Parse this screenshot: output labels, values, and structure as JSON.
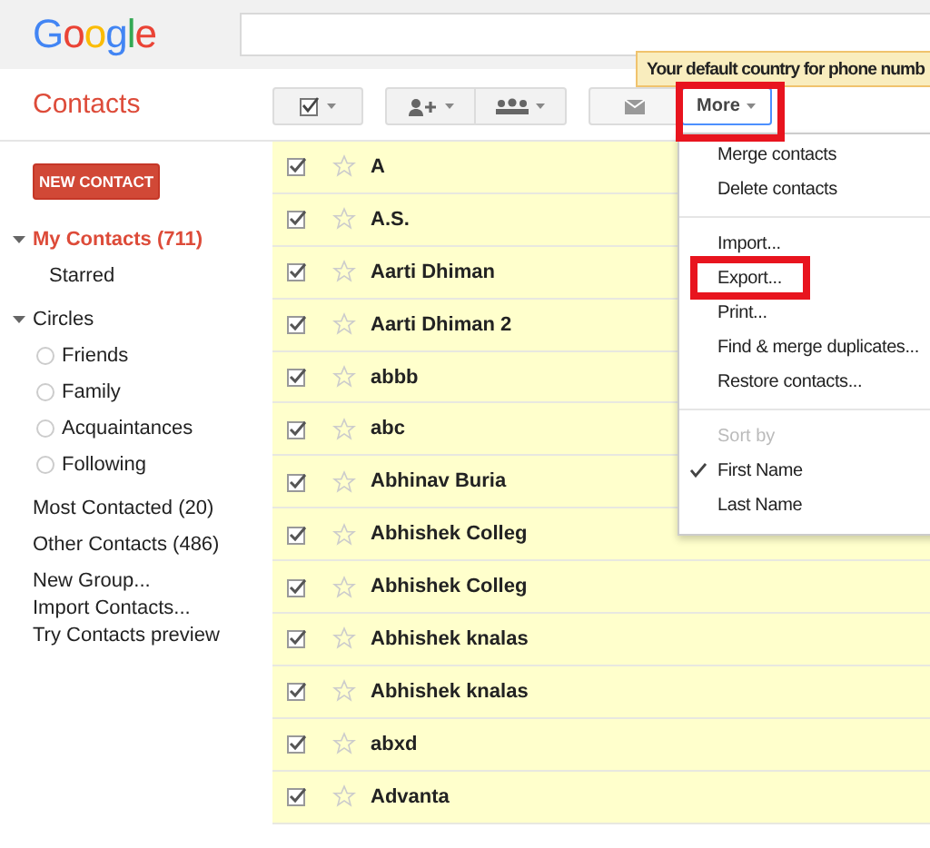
{
  "header": {
    "logo": "Google"
  },
  "app_title": "Contacts",
  "toolbar": [
    {
      "kind": "select"
    },
    {
      "kind": "add_person"
    },
    {
      "kind": "circles"
    },
    {
      "kind": "email"
    },
    {
      "kind": "more",
      "label": "More",
      "selected": true,
      "highlighted": true
    }
  ],
  "tooltip": "Your default country for phone numb",
  "sidebar": {
    "new_contact": "NEW CONTACT",
    "groups": [
      {
        "label": "My Contacts (711)",
        "selected": true,
        "expanded": true,
        "children": [
          {
            "label": "Starred",
            "kind": "plain"
          }
        ]
      },
      {
        "label": "Circles",
        "selected": false,
        "expanded": true,
        "children": [
          {
            "label": "Friends",
            "kind": "circle"
          },
          {
            "label": "Family",
            "kind": "circle"
          },
          {
            "label": "Acquaintances",
            "kind": "circle"
          },
          {
            "label": "Following",
            "kind": "circle"
          }
        ]
      }
    ],
    "counts": [
      "Most Contacted (20)",
      "Other Contacts (486)"
    ],
    "links": [
      "New Group...",
      "Import Contacts...",
      "Try Contacts preview"
    ]
  },
  "contacts": [
    {
      "name": "A",
      "checked": true,
      "starred": false
    },
    {
      "name": "A.S.",
      "checked": true,
      "starred": false
    },
    {
      "name": "Aarti Dhiman",
      "checked": true,
      "starred": false
    },
    {
      "name": "Aarti Dhiman 2",
      "checked": true,
      "starred": false
    },
    {
      "name": "abbb",
      "checked": true,
      "starred": false
    },
    {
      "name": "abc",
      "checked": true,
      "starred": false
    },
    {
      "name": "Abhinav Buria",
      "checked": true,
      "starred": false
    },
    {
      "name": "Abhishek Colleg",
      "checked": true,
      "starred": false
    },
    {
      "name": "Abhishek Colleg",
      "checked": true,
      "starred": false
    },
    {
      "name": "Abhishek knalas",
      "checked": true,
      "starred": false
    },
    {
      "name": "Abhishek knalas",
      "checked": true,
      "starred": false
    },
    {
      "name": "abxd",
      "checked": true,
      "starred": false
    },
    {
      "name": "Advanta",
      "checked": true,
      "starred": false
    }
  ],
  "menu": {
    "sections": [
      {
        "items": [
          {
            "label": "Merge contacts",
            "highlighted": false
          },
          {
            "label": "Delete contacts",
            "highlighted": false
          }
        ]
      },
      {
        "items": [
          {
            "label": "Import...",
            "highlighted": false
          },
          {
            "label": "Export...",
            "highlighted": true
          },
          {
            "label": "Print...",
            "highlighted": false
          },
          {
            "label": "Find & merge duplicates...",
            "highlighted": false
          },
          {
            "label": "Restore contacts...",
            "highlighted": false
          }
        ]
      },
      {
        "heading": "Sort by",
        "items": [
          {
            "label": "First Name",
            "checked": true,
            "highlighted": false
          },
          {
            "label": "Last Name",
            "checked": false,
            "highlighted": false
          }
        ]
      }
    ]
  }
}
